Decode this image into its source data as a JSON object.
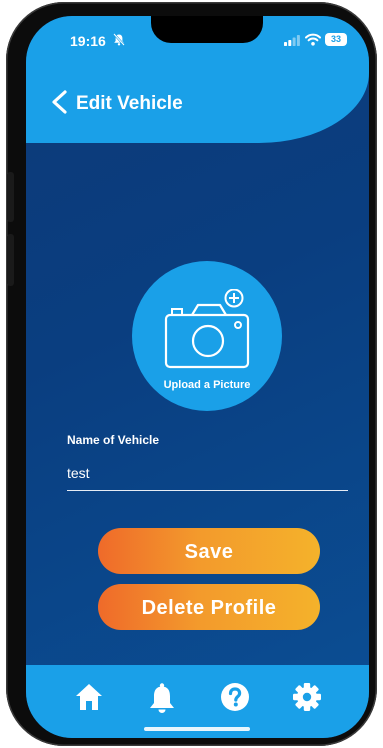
{
  "status_bar": {
    "time": "19:16",
    "battery": "33"
  },
  "header": {
    "title": "Edit Vehicle"
  },
  "upload": {
    "label": "Upload a Picture"
  },
  "form": {
    "name_label": "Name of Vehicle",
    "name_value": "test"
  },
  "buttons": {
    "save": "Save",
    "delete": "Delete Profile"
  },
  "tabbar": {
    "items": [
      "home-icon",
      "bell-icon",
      "help-icon",
      "gear-icon"
    ]
  },
  "colors": {
    "accent": "#1aa0e8",
    "background": "#0d3a78",
    "button_start": "#ef6a2a",
    "button_end": "#f4b22b"
  }
}
